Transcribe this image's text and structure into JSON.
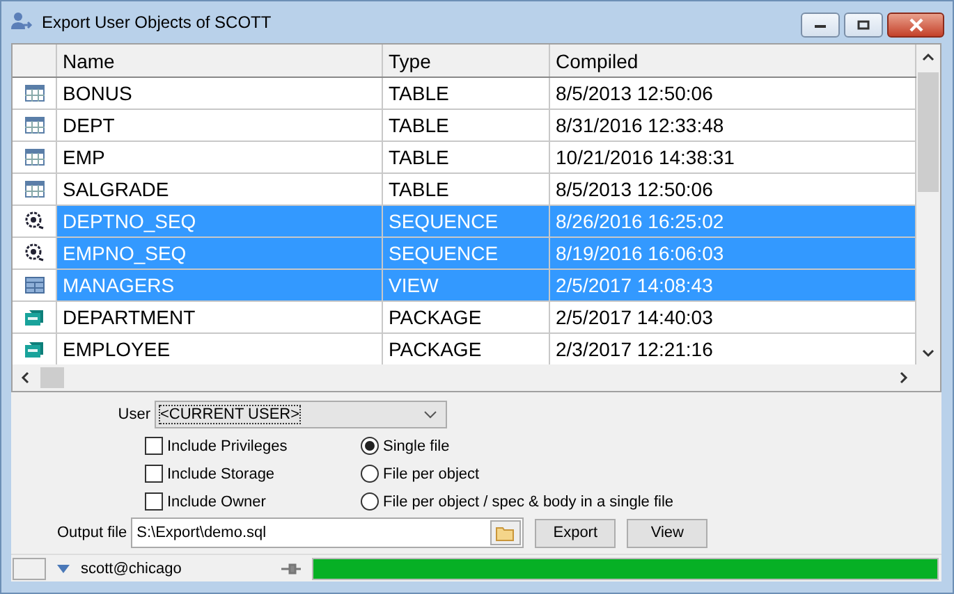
{
  "window": {
    "title": "Export User Objects of SCOTT"
  },
  "table": {
    "columns": [
      "Name",
      "Type",
      "Compiled"
    ],
    "rows": [
      {
        "kind": "table",
        "name": "BONUS",
        "type": "TABLE",
        "compiled": "8/5/2013 12:50:06",
        "selected": false
      },
      {
        "kind": "table",
        "name": "DEPT",
        "type": "TABLE",
        "compiled": "8/31/2016 12:33:48",
        "selected": false
      },
      {
        "kind": "table",
        "name": "EMP",
        "type": "TABLE",
        "compiled": "10/21/2016 14:38:31",
        "selected": false
      },
      {
        "kind": "table",
        "name": "SALGRADE",
        "type": "TABLE",
        "compiled": "8/5/2013 12:50:06",
        "selected": false
      },
      {
        "kind": "sequence",
        "name": "DEPTNO_SEQ",
        "type": "SEQUENCE",
        "compiled": "8/26/2016 16:25:02",
        "selected": true
      },
      {
        "kind": "sequence",
        "name": "EMPNO_SEQ",
        "type": "SEQUENCE",
        "compiled": "8/19/2016 16:06:03",
        "selected": true
      },
      {
        "kind": "view",
        "name": "MANAGERS",
        "type": "VIEW",
        "compiled": "2/5/2017 14:08:43",
        "selected": true
      },
      {
        "kind": "package",
        "name": "DEPARTMENT",
        "type": "PACKAGE",
        "compiled": "2/5/2017 14:40:03",
        "selected": false
      },
      {
        "kind": "package",
        "name": "EMPLOYEE",
        "type": "PACKAGE",
        "compiled": "2/3/2017 12:21:16",
        "selected": false
      }
    ]
  },
  "user": {
    "label": "User",
    "value": "<CURRENT USER>"
  },
  "options": [
    {
      "label": "Include Privileges",
      "checked": false
    },
    {
      "label": "Include Storage",
      "checked": false
    },
    {
      "label": "Include Owner",
      "checked": false
    }
  ],
  "file_modes": [
    {
      "label": "Single file",
      "selected": true
    },
    {
      "label": "File per object",
      "selected": false
    },
    {
      "label": "File per object / spec & body in a single file",
      "selected": false
    }
  ],
  "output_file": {
    "label": "Output file",
    "value": "S:\\Export\\demo.sql"
  },
  "buttons": [
    "Export",
    "View"
  ],
  "status_bar": {
    "connection": "scott@chicago",
    "progress": {
      "level": 1
    }
  }
}
